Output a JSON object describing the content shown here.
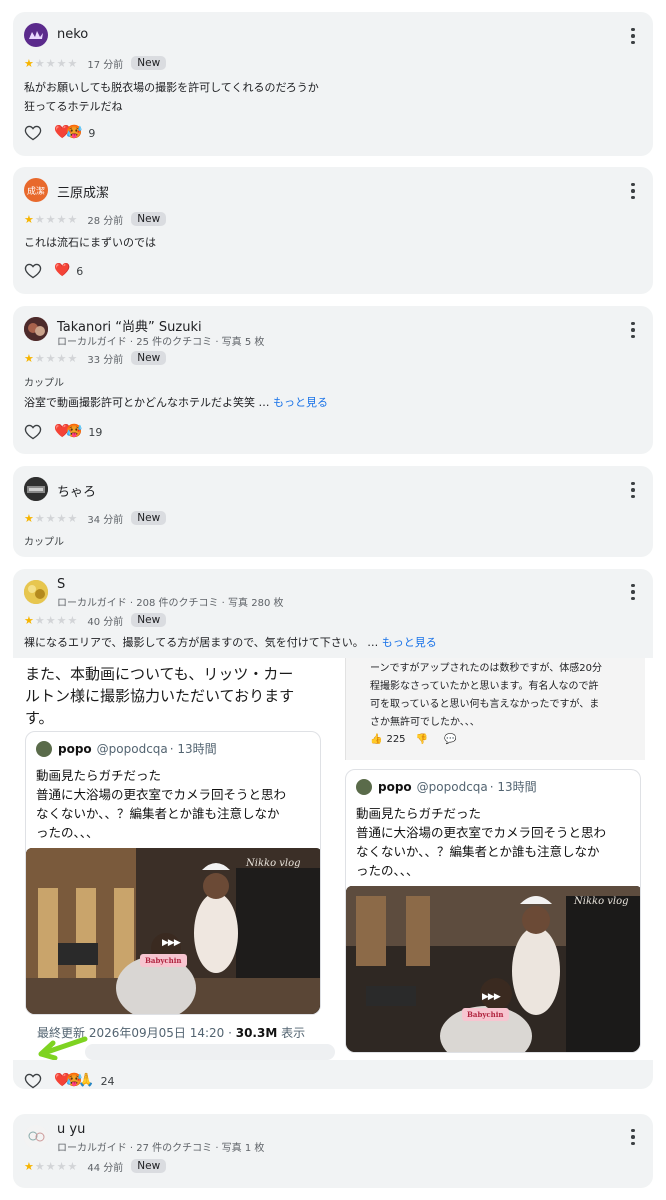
{
  "reviews": [
    {
      "name": "neko",
      "time": "17 分前",
      "badge": "New",
      "stars": 1,
      "lines": [
        "私がお願いしても脱衣場の撮影を許可してくれるのだろうか",
        "狂ってるホテルだね"
      ],
      "emoji": [
        "❤️",
        "🥵"
      ],
      "count": "9"
    },
    {
      "name": "三原成潔",
      "avatar_text": "成潔",
      "time": "28 分前",
      "badge": "New",
      "stars": 1,
      "lines": [
        "これは流石にまずいのでは"
      ],
      "emoji": [
        "❤️"
      ],
      "count": "6"
    },
    {
      "name": "Takanori “尚典” Suzuki",
      "sub": "ローカルガイド · 25 件のクチコミ · 写真 5 枚",
      "time": "33 分前",
      "badge": "New",
      "stars": 1,
      "tag": "カップル",
      "text": "浴室で動画撮影許可とかどんなホテルだよ笑笑 …",
      "more": "もっと見る",
      "emoji": [
        "❤️",
        "🥵"
      ],
      "count": "19"
    },
    {
      "name": "ちゃろ",
      "time": "34 分前",
      "badge": "New",
      "stars": 1,
      "tag": "カップル"
    },
    {
      "name": "S",
      "sub": "ローカルガイド · 208 件のクチコミ · 写真 280 枚",
      "time": "40 分前",
      "badge": "New",
      "stars": 1,
      "text": "裸になるエリアで、撮影してる方が居ますので、気を付けて下さい。 …",
      "more": "もっと見る",
      "embed_count": "24",
      "embed_emoji": [
        "❤️",
        "🥵",
        "🙏"
      ]
    },
    {
      "name": "u yu",
      "sub": "ローカルガイド · 27 件のクチコミ · 写真 1 枚",
      "time": "44 分前",
      "badge": "New",
      "stars": 1
    }
  ],
  "embed": {
    "big_text": [
      "また、本動画についても、リッツ・カー",
      "ルトン様に撮影協力いただいております",
      "す。"
    ],
    "tweet": {
      "name": "popo",
      "handle": "@popodcqa",
      "time": "· 13時間",
      "lines": [
        "動画見たらガチだった",
        "普通に大浴場の更衣室でカメラ回そうと思わ",
        "なくないか、、？編集者とか誰も注意しなか",
        "ったの、、、"
      ]
    },
    "tweet2_lines": [
      "動画見たらガチだった",
      "普通に大浴場の更衣室でカメラ回そうと思わ",
      "なくないか、、？編集者とか誰も注意しなか",
      "ったの、、、"
    ],
    "vlog_label": "Nikko vlog",
    "pink_label": "Babychin",
    "updated_prefix": "最終更新 2026年09月05日 14:20 · ",
    "views": "30.3M",
    "views_suffix": " 表示",
    "right_lines": [
      "ーンですがアップされたのは数秒ですが、体感20分",
      "程撮影なさっていたかと思います。有名人なので許",
      "可を取っていると思い何も言えなかったですが、ま",
      "さか無許可でしたか、、、"
    ],
    "right_likes": "225"
  }
}
